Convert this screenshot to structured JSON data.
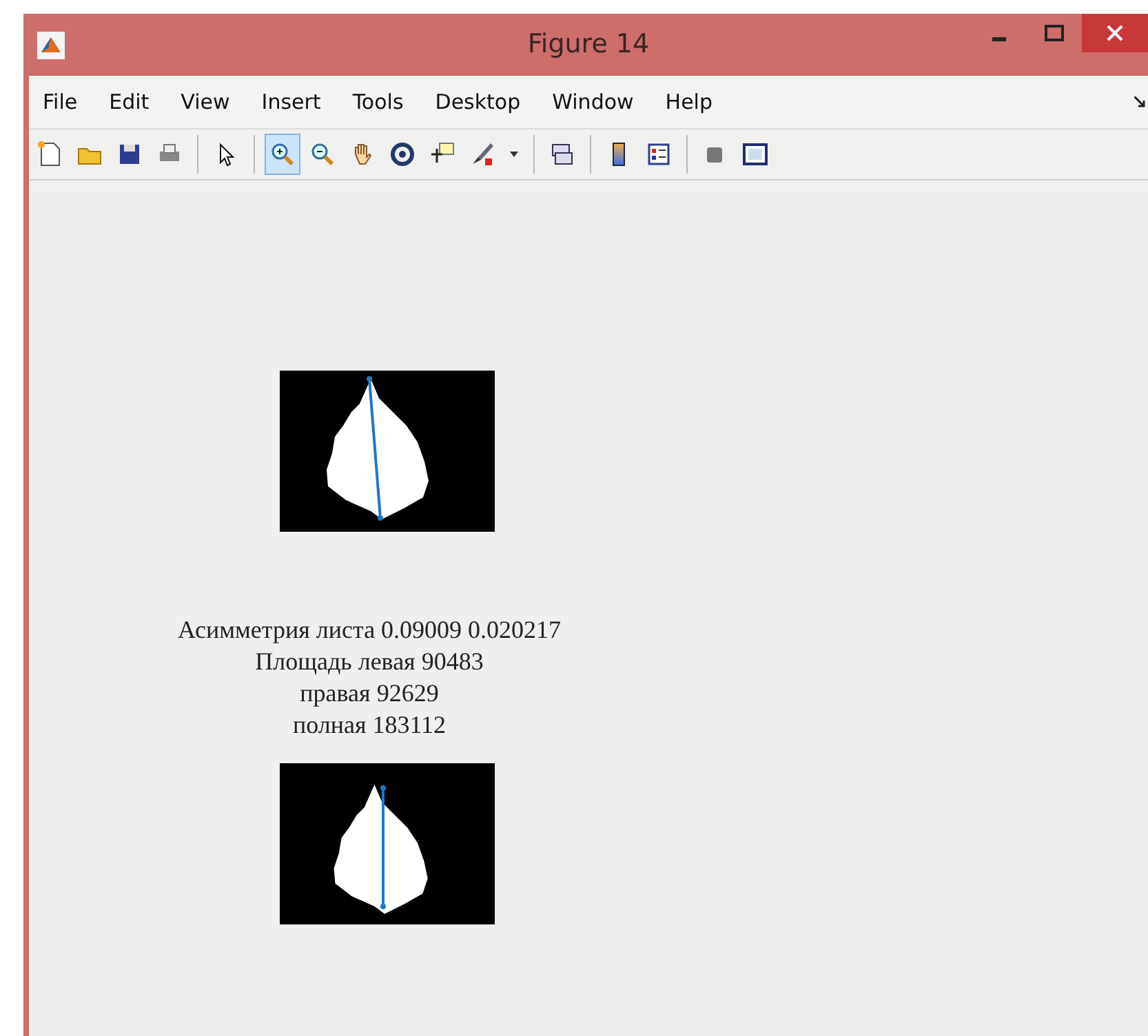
{
  "window": {
    "title": "Figure 14"
  },
  "menu": [
    "File",
    "Edit",
    "View",
    "Insert",
    "Tools",
    "Desktop",
    "Window",
    "Help"
  ],
  "toolbar": [
    {
      "kind": "new",
      "selected": false
    },
    {
      "kind": "open",
      "selected": false
    },
    {
      "kind": "save",
      "selected": false
    },
    {
      "kind": "print",
      "selected": false
    },
    {
      "kind": "sep"
    },
    {
      "kind": "pointer",
      "selected": false
    },
    {
      "kind": "sep"
    },
    {
      "kind": "zoomin",
      "selected": true
    },
    {
      "kind": "zoomout",
      "selected": false
    },
    {
      "kind": "pan",
      "selected": false
    },
    {
      "kind": "rotate",
      "selected": false
    },
    {
      "kind": "datacursor",
      "selected": false
    },
    {
      "kind": "brush",
      "selected": false
    },
    {
      "kind": "dropdown",
      "selected": false
    },
    {
      "kind": "sep"
    },
    {
      "kind": "link",
      "selected": false
    },
    {
      "kind": "sep"
    },
    {
      "kind": "colorbar",
      "selected": false
    },
    {
      "kind": "legend",
      "selected": false
    },
    {
      "kind": "sep"
    },
    {
      "kind": "hide",
      "selected": false
    },
    {
      "kind": "dock",
      "selected": false
    }
  ],
  "figure": {
    "caption": [
      "Асимметрия листа 0.09009 0.020217",
      "Площадь левая 90483",
      "правая 92629",
      "полная 183112"
    ]
  }
}
